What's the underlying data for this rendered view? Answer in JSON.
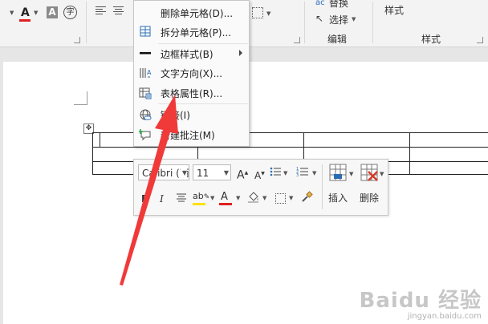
{
  "ribbon": {
    "editing_group": {
      "replace_label": "替换",
      "select_label": "选择",
      "group_label": "编辑"
    },
    "styles_group": {
      "styles_button_label": "样式",
      "group_label": "样式"
    },
    "char_border_glyph": "字"
  },
  "context_menu": {
    "items": [
      {
        "label": "删除单元格(D)...",
        "icon": "none"
      },
      {
        "label": "拆分单元格(P)...",
        "icon": "split-cells-icon"
      },
      {
        "label": "边框样式(B)",
        "icon": "border-line-icon",
        "submenu": true
      },
      {
        "label": "文字方向(X)...",
        "icon": "text-direction-icon"
      },
      {
        "label": "表格属性(R)...",
        "icon": "table-properties-icon"
      },
      {
        "label": "链接(I)",
        "icon": "link-icon"
      },
      {
        "label": "新建批注(M)",
        "icon": "new-comment-icon"
      }
    ]
  },
  "mini_toolbar": {
    "font_name": "Calibri (西",
    "font_size": "11",
    "insert_label": "插入",
    "delete_label": "删除"
  },
  "colors": {
    "font_color": "#e02020",
    "highlight": "#ffe000",
    "annotation_arrow": "#f03a3a"
  },
  "watermark": {
    "main": "Baidu 经验",
    "sub": "jingyan.baidu.com"
  }
}
